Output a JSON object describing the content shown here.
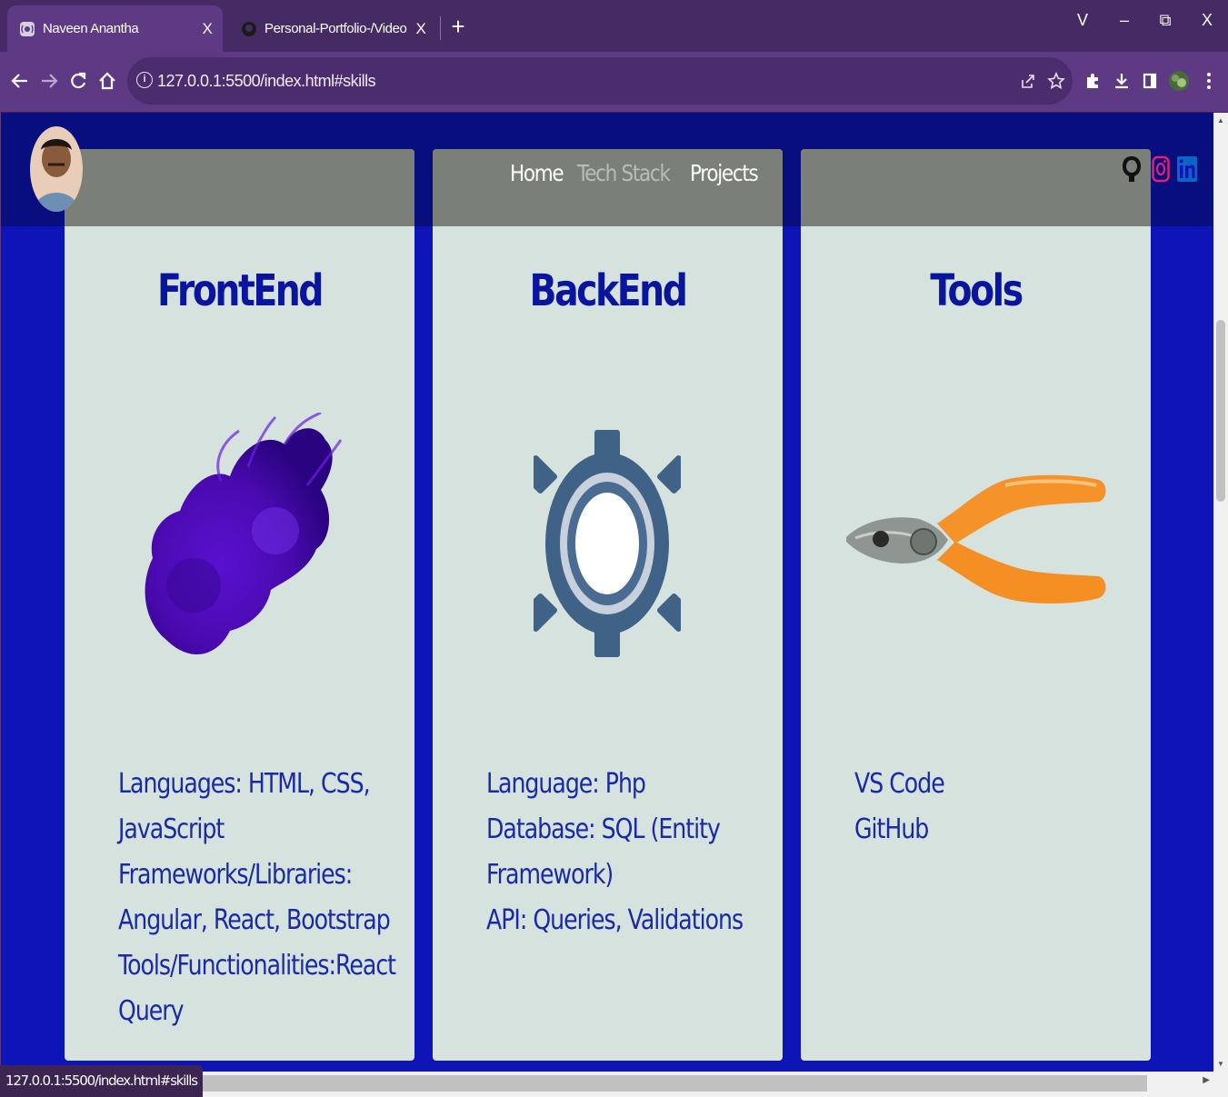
{
  "browser": {
    "tabs": [
      {
        "title": "Naveen Anantha",
        "close": "X"
      },
      {
        "title": "Personal-Portfolio-/Video Demo/",
        "close": "X"
      }
    ],
    "new_tab": "+",
    "window_controls": {
      "dropdown": "V",
      "minimize": "–",
      "restore": "⧉",
      "close": "X"
    },
    "url": "127.0.0.1:5500/index.html#skills",
    "status_url": "127.0.0.1:5500/index.html#skills",
    "accent": "#5e3a85"
  },
  "header": {
    "nav": [
      {
        "label": "Home"
      },
      {
        "label": "Tech Stack"
      },
      {
        "label": "Projects"
      }
    ],
    "social": [
      "github-icon",
      "instagram-icon",
      "linkedin-icon"
    ]
  },
  "skills": [
    {
      "title": "FrontEnd",
      "art": "purple-ink-smoke-image",
      "items": [
        "Languages: HTML, CSS,",
        "JavaScript",
        "Frameworks/Libraries:",
        "Angular, React, Bootstrap",
        "Tools/Functionalities:React",
        "Query"
      ]
    },
    {
      "title": "BackEnd",
      "art": "gear-icon",
      "items": [
        "Language: Php",
        "Database: SQL (Entity",
        "Framework)",
        "API: Queries, Validations"
      ]
    },
    {
      "title": "Tools",
      "art": "pliers-image",
      "items": [
        "VS Code",
        "GitHub"
      ]
    }
  ],
  "colors": {
    "page_bg": "#0e14b5",
    "card_bg": "#d6e2de",
    "title": "#0a159e",
    "text": "#1a2aa6"
  }
}
